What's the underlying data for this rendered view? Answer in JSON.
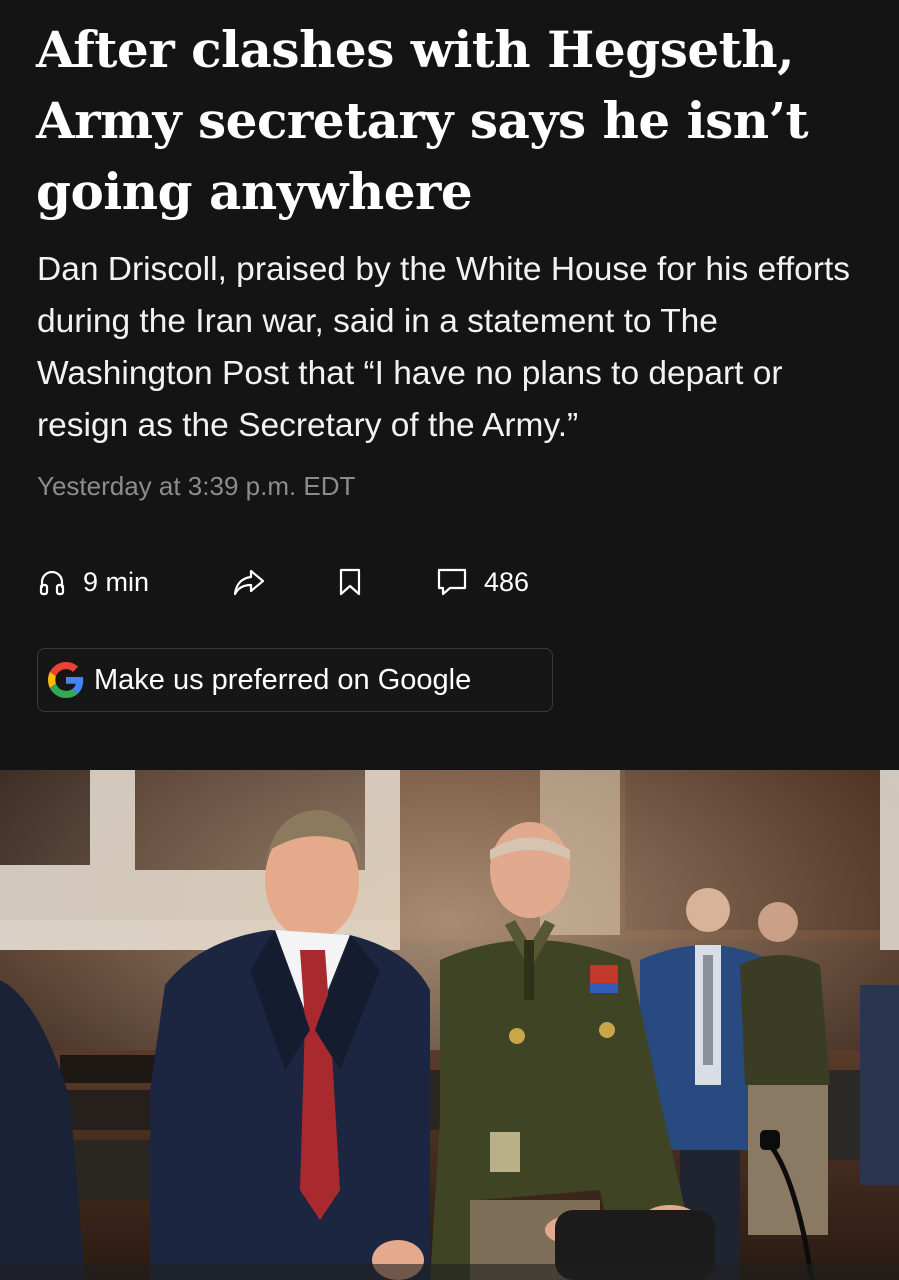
{
  "article": {
    "headline": "After clashes with Hegseth, Army secretary says he isn’t going anywhere",
    "dek": "Dan Driscoll, praised by the White House for his efforts during the Iran war, said in a statement to The Washington Post that “I have no plans to depart or resign as the Secretary of the Army.”",
    "timestamp": "Yesterday at 3:39 p.m. EDT"
  },
  "actions": {
    "listen": {
      "icon": "headphones-icon",
      "label": "9 min"
    },
    "share": {
      "icon": "share-arrow-icon"
    },
    "save": {
      "icon": "bookmark-icon"
    },
    "comments": {
      "icon": "comment-icon",
      "count": "486"
    }
  },
  "google_button": {
    "icon": "google-g-icon",
    "label": "Make us preferred on Google"
  },
  "photo": {
    "subject": "two men standing in a hearing room, one in a dark suit with red tie, one in army dress uniform"
  },
  "colors": {
    "background": "#141414",
    "text": "#ffffff",
    "muted": "#8c8c8c",
    "button_border": "#3a3a3a"
  }
}
